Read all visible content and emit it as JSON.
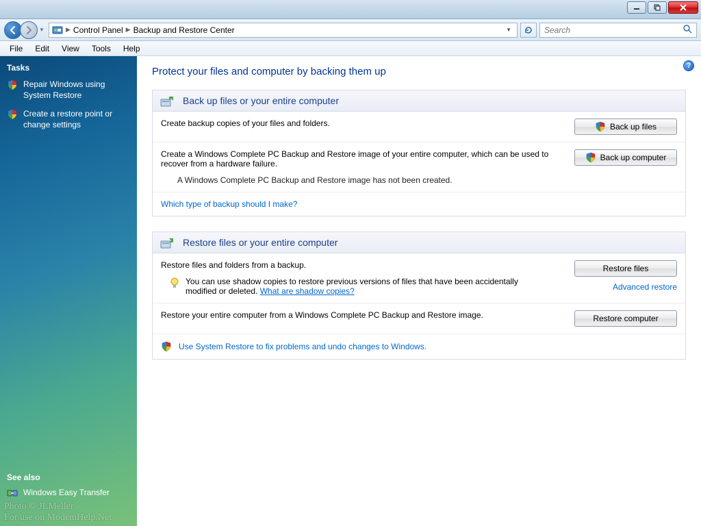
{
  "window": {
    "controls": {
      "minimize": "min",
      "maximize": "max",
      "close": "close"
    }
  },
  "breadcrumb": {
    "control_panel": "Control Panel",
    "current": "Backup and Restore Center"
  },
  "search": {
    "placeholder": "Search"
  },
  "menu": {
    "file": "File",
    "edit": "Edit",
    "view": "View",
    "tools": "Tools",
    "help": "Help"
  },
  "sidebar": {
    "tasks_head": "Tasks",
    "tasks": [
      {
        "label": "Repair Windows using System Restore"
      },
      {
        "label": "Create a restore point or change settings"
      }
    ],
    "see_also_head": "See also",
    "see_also": [
      {
        "label": "Windows Easy Transfer"
      }
    ]
  },
  "page": {
    "title": "Protect your files and computer by backing them up"
  },
  "backup_panel": {
    "title": "Back up files or your entire computer",
    "row1_text": "Create backup copies of your files and folders.",
    "row1_button": "Back up files",
    "row2_text": "Create a Windows Complete PC Backup and Restore image of your entire computer, which can be used to recover from a hardware failure.",
    "row2_note": "A Windows Complete PC Backup and Restore image has not been created.",
    "row2_button": "Back up computer",
    "help_link": "Which type of backup should I make?"
  },
  "restore_panel": {
    "title": "Restore files or your entire computer",
    "row1_text": "Restore files and folders from a backup.",
    "row1_button": "Restore files",
    "advanced_link": "Advanced restore",
    "tip_text": "You can use shadow copies to restore previous versions of files that have been accidentally modified or deleted. ",
    "tip_link": "What are shadow copies?",
    "row2_text": "Restore your entire computer from a Windows Complete PC Backup and Restore image.",
    "row2_button": "Restore computer",
    "sysrestore_link": "Use System Restore to fix problems and undo changes to Windows."
  },
  "watermark": {
    "line1": "Photo © JLMeller",
    "line2": "For use on ModemHelp.Net"
  }
}
